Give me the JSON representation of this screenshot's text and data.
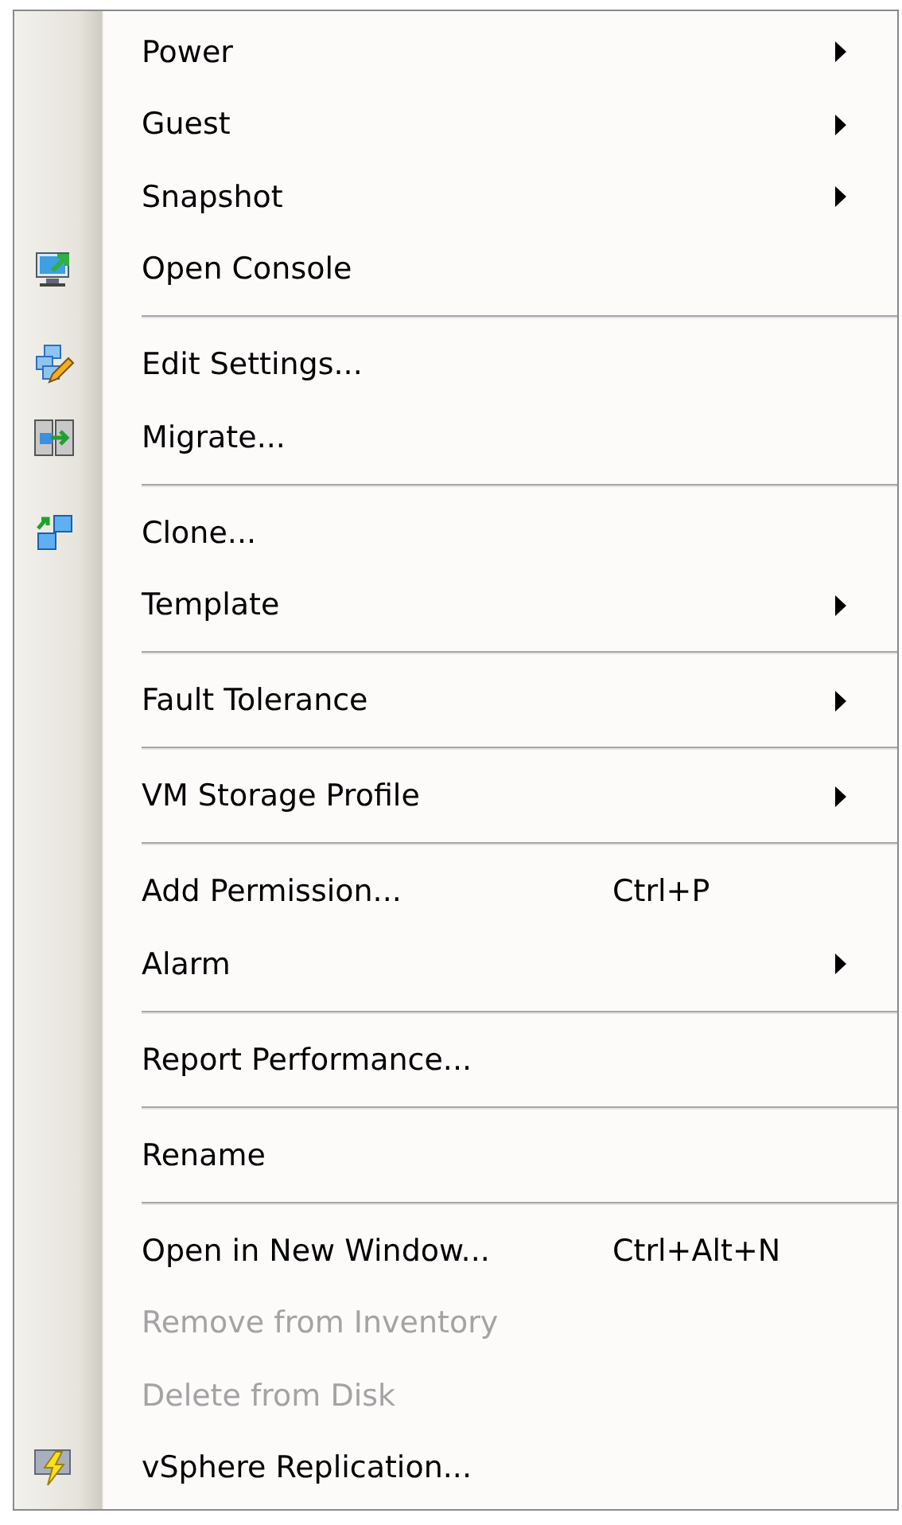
{
  "menu": {
    "groups": [
      {
        "items": [
          {
            "label": "Power",
            "submenu": true,
            "disabled": false,
            "kind": "plain"
          },
          {
            "label": "Guest",
            "submenu": true,
            "disabled": false,
            "kind": "plain"
          },
          {
            "label": "Snapshot",
            "submenu": true,
            "disabled": false,
            "kind": "plain"
          },
          {
            "label": "Open Console",
            "submenu": false,
            "disabled": false,
            "kind": "console"
          }
        ]
      },
      {
        "items": [
          {
            "label": "Edit Settings...",
            "submenu": false,
            "disabled": false,
            "kind": "edit"
          },
          {
            "label": "Migrate...",
            "submenu": false,
            "disabled": false,
            "kind": "migrate"
          }
        ]
      },
      {
        "items": [
          {
            "label": "Clone...",
            "submenu": false,
            "disabled": false,
            "kind": "clone"
          },
          {
            "label": "Template",
            "submenu": true,
            "disabled": false,
            "kind": "plain"
          }
        ]
      },
      {
        "items": [
          {
            "label": "Fault Tolerance",
            "submenu": true,
            "disabled": false,
            "kind": "plain"
          }
        ]
      },
      {
        "items": [
          {
            "label": "VM Storage Profile",
            "submenu": true,
            "disabled": false,
            "kind": "plain"
          }
        ]
      },
      {
        "items": [
          {
            "label": "Add Permission...",
            "shortcut": "Ctrl+P",
            "submenu": false,
            "disabled": false,
            "kind": "plain"
          },
          {
            "label": "Alarm",
            "submenu": true,
            "disabled": false,
            "kind": "plain"
          }
        ]
      },
      {
        "items": [
          {
            "label": "Report Performance...",
            "submenu": false,
            "disabled": false,
            "kind": "plain"
          }
        ]
      },
      {
        "items": [
          {
            "label": "Rename",
            "submenu": false,
            "disabled": false,
            "kind": "plain"
          }
        ]
      },
      {
        "items": [
          {
            "label": "Open in New Window...",
            "shortcut": "Ctrl+Alt+N",
            "submenu": false,
            "disabled": false,
            "kind": "plain"
          },
          {
            "label": "Remove from Inventory",
            "submenu": false,
            "disabled": true,
            "kind": "plain"
          },
          {
            "label": "Delete from Disk",
            "submenu": false,
            "disabled": true,
            "kind": "plain"
          },
          {
            "label": "vSphere Replication...",
            "submenu": false,
            "disabled": false,
            "kind": "replication"
          }
        ]
      }
    ]
  }
}
